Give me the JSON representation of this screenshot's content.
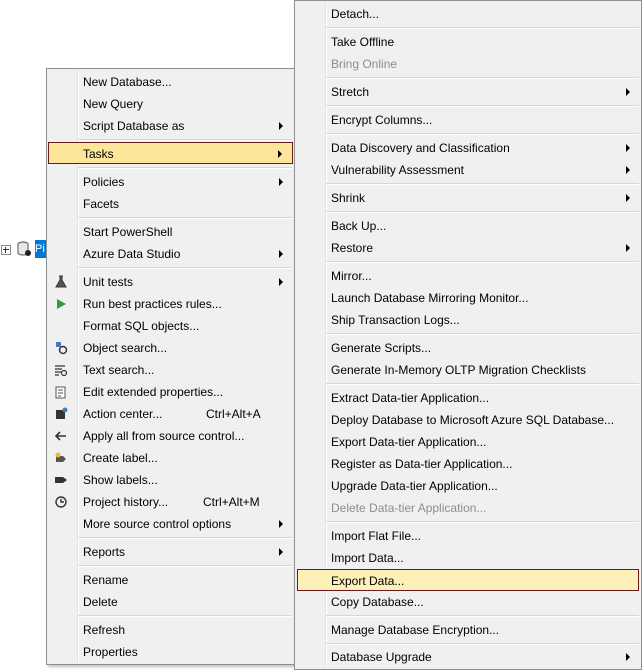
{
  "tree": {
    "node_label": "Pi"
  },
  "main_menu": {
    "new_database": "New Database...",
    "new_query": "New Query",
    "script_database_as": "Script Database as",
    "tasks": "Tasks",
    "policies": "Policies",
    "facets": "Facets",
    "start_powershell": "Start PowerShell",
    "azure_data_studio": "Azure Data Studio",
    "unit_tests": "Unit tests",
    "run_best_practices": "Run best practices rules...",
    "format_sql": "Format SQL objects...",
    "object_search": "Object search...",
    "text_search": "Text search...",
    "edit_extended_properties": "Edit extended properties...",
    "action_center": "Action center...",
    "action_center_shortcut": "Ctrl+Alt+A",
    "apply_all": "Apply all from source control...",
    "create_label": "Create label...",
    "show_labels": "Show labels...",
    "project_history": "Project history...",
    "project_history_shortcut": "Ctrl+Alt+M",
    "more_source_control": "More source control options",
    "reports": "Reports",
    "rename": "Rename",
    "delete": "Delete",
    "refresh": "Refresh",
    "properties": "Properties"
  },
  "tasks_menu": {
    "detach": "Detach...",
    "take_offline": "Take Offline",
    "bring_online": "Bring Online",
    "stretch": "Stretch",
    "encrypt_columns": "Encrypt Columns...",
    "data_discovery": "Data Discovery and Classification",
    "vulnerability_assessment": "Vulnerability Assessment",
    "shrink": "Shrink",
    "back_up": "Back Up...",
    "restore": "Restore",
    "mirror": "Mirror...",
    "launch_mirroring_monitor": "Launch Database Mirroring Monitor...",
    "ship_transaction_logs": "Ship Transaction Logs...",
    "generate_scripts": "Generate Scripts...",
    "generate_inmemory": "Generate In-Memory OLTP Migration Checklists",
    "extract_data_tier": "Extract Data-tier Application...",
    "deploy_to_azure": "Deploy Database to Microsoft Azure SQL Database...",
    "export_data_tier": "Export Data-tier Application...",
    "register_data_tier": "Register as Data-tier Application...",
    "upgrade_data_tier": "Upgrade Data-tier Application...",
    "delete_data_tier": "Delete Data-tier Application...",
    "import_flat_file": "Import Flat File...",
    "import_data": "Import Data...",
    "export_data": "Export Data...",
    "copy_database": "Copy Database...",
    "manage_encryption": "Manage Database Encryption...",
    "database_upgrade": "Database Upgrade"
  }
}
